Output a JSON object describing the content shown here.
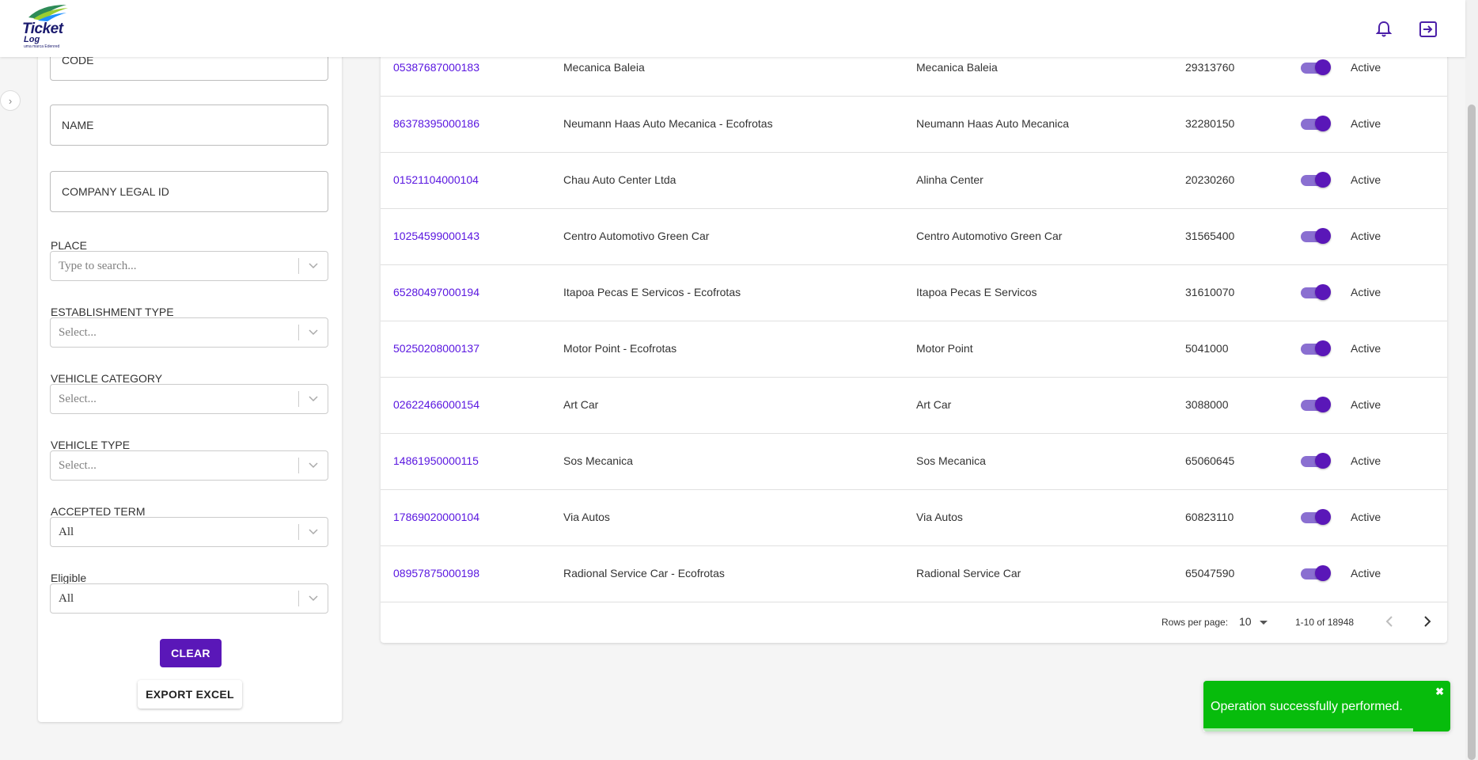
{
  "header": {
    "logo_line1": "Ticket",
    "logo_line2": "Log",
    "logo_tagline": "uma marca Edenred",
    "notifications_icon": "bell-icon",
    "logout_icon": "logout-icon"
  },
  "filters": {
    "code_label": "CODE",
    "name_label": "NAME",
    "legal_id_label": "COMPANY LEGAL ID",
    "place_label": "PLACE",
    "place_placeholder": "Type to search...",
    "establishment_type_label": "ESTABLISHMENT TYPE",
    "establishment_type_value": "Select...",
    "vehicle_category_label": "VEHICLE CATEGORY",
    "vehicle_category_value": "Select...",
    "vehicle_type_label": "VEHICLE TYPE",
    "vehicle_type_value": "Select...",
    "accepted_term_label": "ACCEPTED TERM",
    "accepted_term_value": "All",
    "eligible_label": "Eligible",
    "eligible_value": "All",
    "clear_label": "CLEAR",
    "export_label": "EXPORT EXCEL"
  },
  "table": {
    "rows": [
      {
        "id": "05387687000183",
        "name": "Mecanica Baleia",
        "trade_name": "Mecanica Baleia",
        "code": "29313760",
        "active": true,
        "status": "Active"
      },
      {
        "id": "86378395000186",
        "name": "Neumann Haas Auto Mecanica - Ecofrotas",
        "trade_name": "Neumann Haas Auto Mecanica",
        "code": "32280150",
        "active": true,
        "status": "Active"
      },
      {
        "id": "01521104000104",
        "name": "Chau Auto Center Ltda",
        "trade_name": "Alinha Center",
        "code": "20230260",
        "active": true,
        "status": "Active"
      },
      {
        "id": "10254599000143",
        "name": "Centro Automotivo Green Car",
        "trade_name": "Centro Automotivo Green Car",
        "code": "31565400",
        "active": true,
        "status": "Active"
      },
      {
        "id": "65280497000194",
        "name": "Itapoa Pecas E Servicos - Ecofrotas",
        "trade_name": "Itapoa Pecas E Servicos",
        "code": "31610070",
        "active": true,
        "status": "Active"
      },
      {
        "id": "50250208000137",
        "name": "Motor Point - Ecofrotas",
        "trade_name": "Motor Point",
        "code": "5041000",
        "active": true,
        "status": "Active"
      },
      {
        "id": "02622466000154",
        "name": "Art Car",
        "trade_name": "Art Car",
        "code": "3088000",
        "active": true,
        "status": "Active"
      },
      {
        "id": "14861950000115",
        "name": "Sos Mecanica",
        "trade_name": "Sos Mecanica",
        "code": "65060645",
        "active": true,
        "status": "Active"
      },
      {
        "id": "17869020000104",
        "name": "Via Autos",
        "trade_name": "Via Autos",
        "code": "60823110",
        "active": true,
        "status": "Active"
      },
      {
        "id": "08957875000198",
        "name": "Radional Service Car - Ecofrotas",
        "trade_name": "Radional Service Car",
        "code": "65047590",
        "active": true,
        "status": "Active"
      }
    ]
  },
  "pagination": {
    "rows_per_page_label": "Rows per page:",
    "rows_per_page_value": "10",
    "range": "1-10 of 18948"
  },
  "toast": {
    "message": "Operation successfully performed.",
    "close_glyph": "✖"
  }
}
